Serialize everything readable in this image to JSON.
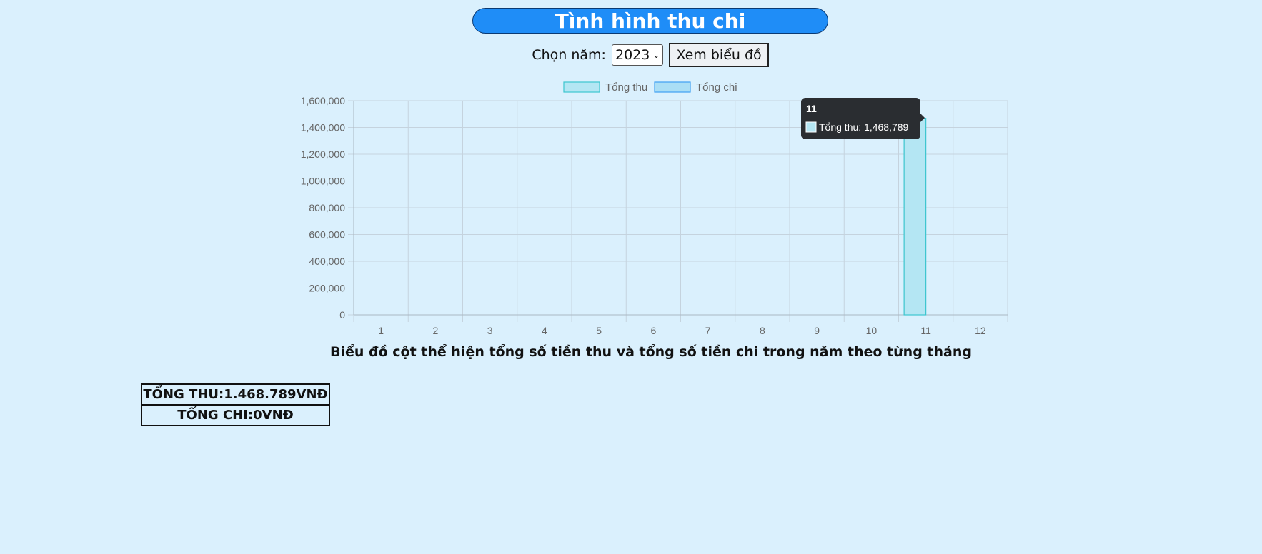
{
  "page": {
    "title": "Tình hình thu chi",
    "year_label": "Chọn năm:",
    "year_selected": "2023",
    "view_button": "Xem biểu đồ"
  },
  "chart_data": {
    "type": "bar",
    "categories": [
      "1",
      "2",
      "3",
      "4",
      "5",
      "6",
      "7",
      "8",
      "9",
      "10",
      "11",
      "12"
    ],
    "series": [
      {
        "name": "Tổng thu",
        "values": [
          0,
          0,
          0,
          0,
          0,
          0,
          0,
          0,
          0,
          0,
          1468789,
          0
        ],
        "color": "#b4e6f3",
        "border": "#3cc6cf"
      },
      {
        "name": "Tổng chi",
        "values": [
          0,
          0,
          0,
          0,
          0,
          0,
          0,
          0,
          0,
          0,
          0,
          0
        ],
        "color": "#aadef5",
        "border": "#3fa0f2"
      }
    ],
    "ylim": [
      0,
      1600000
    ],
    "yticks": [
      "0",
      "200,000",
      "400,000",
      "600,000",
      "800,000",
      "1,000,000",
      "1,200,000",
      "1,400,000",
      "1,600,000"
    ],
    "ytick_values": [
      0,
      200000,
      400000,
      600000,
      800000,
      1000000,
      1200000,
      1400000,
      1600000
    ],
    "grid": true,
    "legend": "top",
    "caption": "Biểu đồ cột thể hiện tổng số tiền thu và tổng số tiền chi trong năm theo từng tháng",
    "tooltip": {
      "title": "11",
      "text": "Tổng thu: 1,468,789"
    }
  },
  "totals": {
    "income": "TỔNG THU:1.468.789VNĐ",
    "expense": "TỔNG CHI:0VNĐ"
  }
}
